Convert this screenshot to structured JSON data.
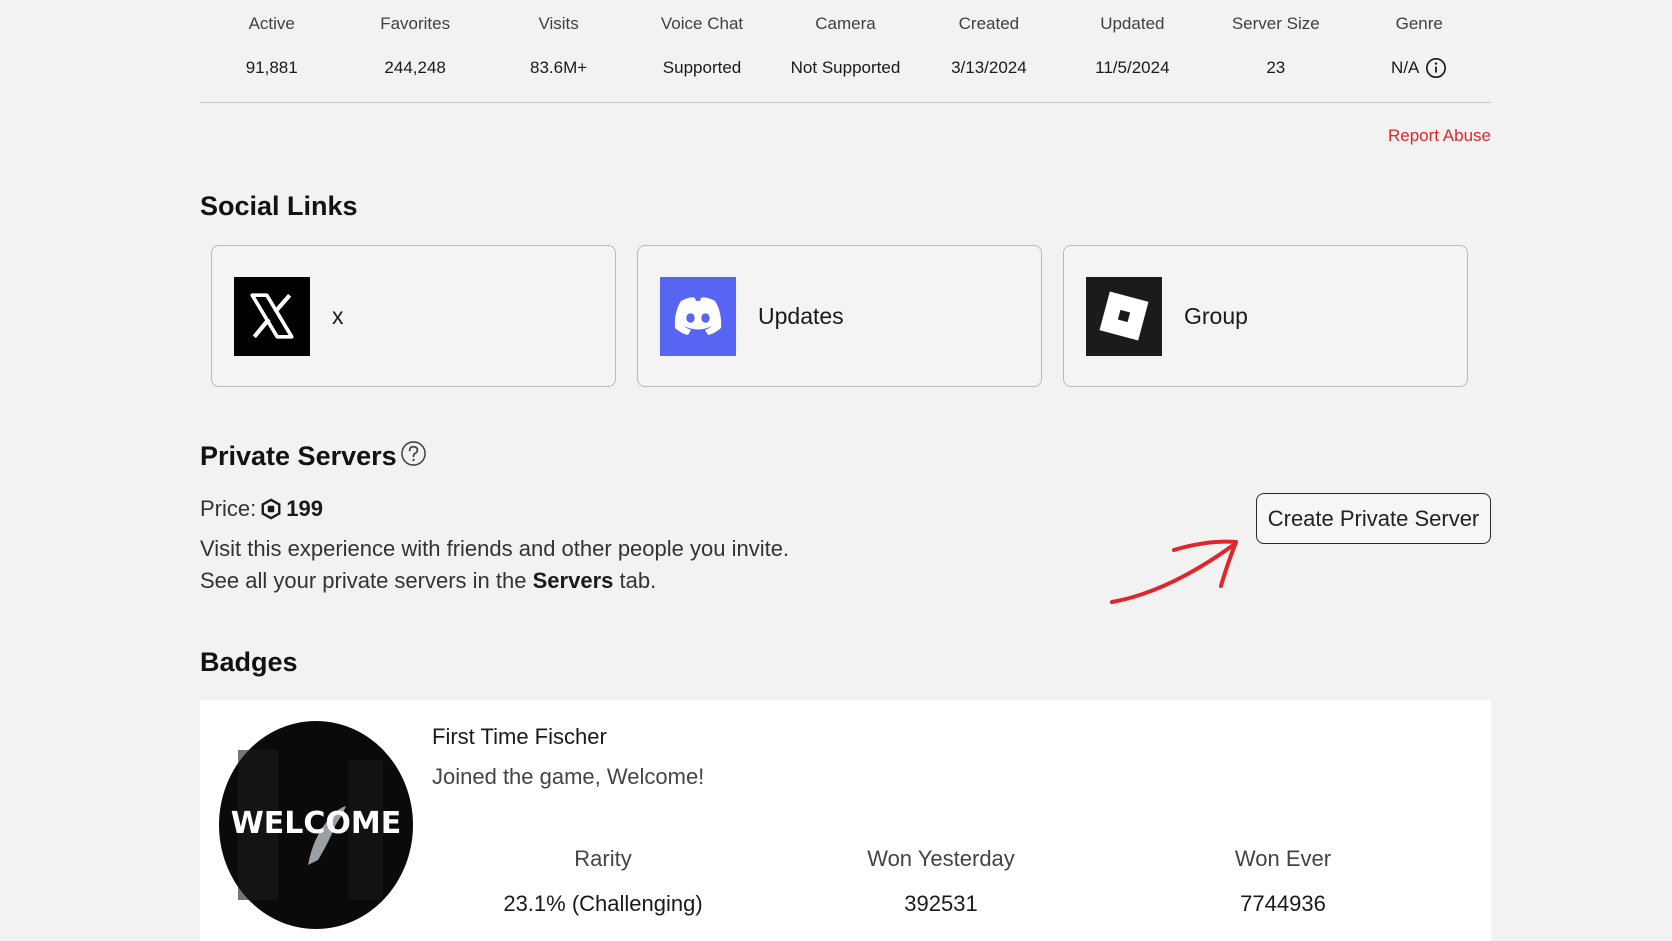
{
  "stats": [
    {
      "label": "Active",
      "value": "91,881"
    },
    {
      "label": "Favorites",
      "value": "244,248"
    },
    {
      "label": "Visits",
      "value": "83.6M+"
    },
    {
      "label": "Voice Chat",
      "value": "Supported"
    },
    {
      "label": "Camera",
      "value": "Not Supported"
    },
    {
      "label": "Created",
      "value": "3/13/2024"
    },
    {
      "label": "Updated",
      "value": "11/5/2024"
    },
    {
      "label": "Server Size",
      "value": "23"
    },
    {
      "label": "Genre",
      "value": "N/A",
      "icon": "info-icon"
    }
  ],
  "report_abuse": "Report Abuse",
  "social": {
    "title": "Social Links",
    "links": [
      {
        "label": "x",
        "icon": "x-logo-icon",
        "color": "#000000"
      },
      {
        "label": "Updates",
        "icon": "discord-logo-icon",
        "color": "#5865f2"
      },
      {
        "label": "Group",
        "icon": "roblox-logo-icon",
        "color": "#1b1b1b"
      }
    ]
  },
  "private_servers": {
    "title": "Private Servers",
    "help_icon": "question-circle-icon",
    "price_label": "Price:",
    "price_icon": "robux-icon",
    "price_value": "199",
    "desc_line1": "Visit this experience with friends and other people you invite.",
    "desc_line2_pre": "See all your private servers in the",
    "desc_line2_bold": "Servers",
    "desc_line2_post": "tab.",
    "create_button": "Create Private Server",
    "annotation": "red-arrow-icon"
  },
  "badges": {
    "title": "Badges",
    "items": [
      {
        "image_text": "WELCOME",
        "name": "First Time Fischer",
        "description": "Joined the game, Welcome!",
        "stats": [
          {
            "label": "Rarity",
            "value": "23.1% (Challenging)"
          },
          {
            "label": "Won Yesterday",
            "value": "392531"
          },
          {
            "label": "Won Ever",
            "value": "7744936"
          }
        ]
      }
    ]
  },
  "colors": {
    "background": "#f2f2f2",
    "report_red": "#e0262b",
    "discord_blurple": "#5865f2",
    "arrow_red": "#e0262b"
  }
}
